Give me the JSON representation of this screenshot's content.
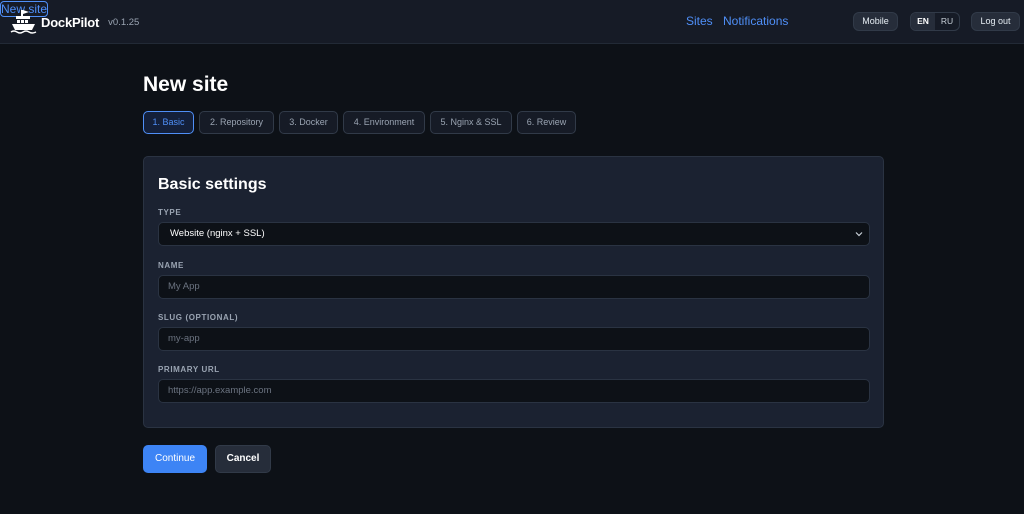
{
  "header": {
    "brand": "DockPilot",
    "version": "v0.1.25",
    "nav": {
      "sites": "Sites",
      "notifications": "Notifications",
      "new_site": "New site"
    },
    "mobile": "Mobile",
    "lang": {
      "en": "EN",
      "ru": "RU",
      "active": "EN"
    },
    "logout": "Log out"
  },
  "page": {
    "title": "New site",
    "steps": [
      {
        "label": "1. Basic",
        "active": true
      },
      {
        "label": "2. Repository",
        "active": false
      },
      {
        "label": "3. Docker",
        "active": false
      },
      {
        "label": "4. Environment",
        "active": false
      },
      {
        "label": "5. Nginx & SSL",
        "active": false
      },
      {
        "label": "6. Review",
        "active": false
      }
    ],
    "card": {
      "title": "Basic settings",
      "type": {
        "label": "TYPE",
        "value": "Website (nginx + SSL)"
      },
      "name": {
        "label": "NAME",
        "placeholder": "My App"
      },
      "slug": {
        "label": "SLUG (OPTIONAL)",
        "placeholder": "my-app"
      },
      "primary_url": {
        "label": "PRIMARY URL",
        "placeholder": "https://app.example.com"
      }
    },
    "actions": {
      "continue": "Continue",
      "cancel": "Cancel"
    }
  },
  "icons": {
    "logo": "ship-logo-icon",
    "select_arrow": "chevron-down-icon"
  },
  "colors": {
    "accent": "#4f8ff7",
    "primary_button": "#3d84f5",
    "background": "#0d1117",
    "card": "#1b2231"
  }
}
